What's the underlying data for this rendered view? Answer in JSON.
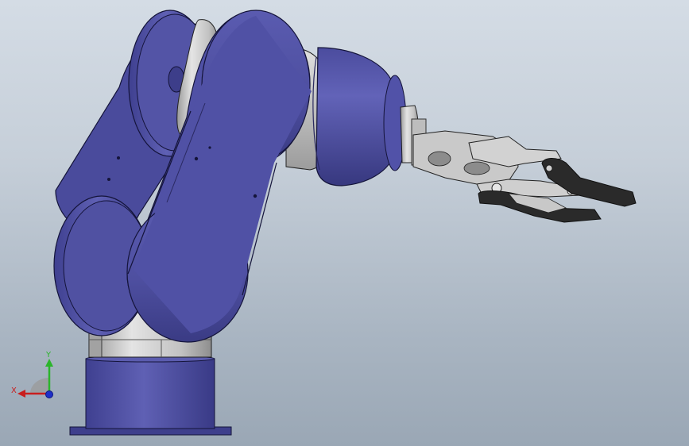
{
  "viewport": {
    "background_top": "#d4dce5",
    "background_bottom": "#9aa7b5"
  },
  "model": {
    "body_color": "#5455a4",
    "metal_color": "#c8c8c8",
    "gripper_tip_color": "#2a2a2a"
  },
  "triad": {
    "y_label": "Y",
    "x_label": "X",
    "y_color": "#2bb52b",
    "x_color": "#c81e1e",
    "z_color": "#1e2fc8"
  }
}
